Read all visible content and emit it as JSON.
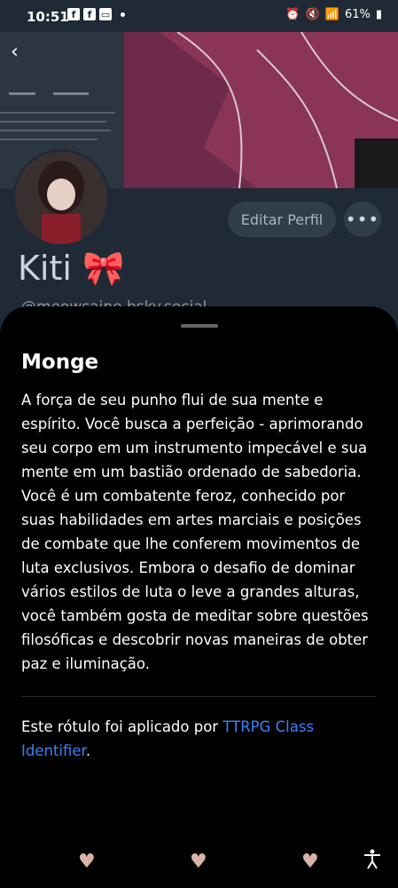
{
  "status": {
    "time": "10:51",
    "battery": "61%"
  },
  "profile": {
    "name": "Kiti 🎀",
    "handle": "@meowsaine.bsky.social",
    "edit_label": "Editar Perfil",
    "more_label": "•••",
    "back_label": "‹"
  },
  "sheet": {
    "title": "Monge",
    "description": "A força de seu punho flui de sua mente e espírito. Você busca a perfeição - aprimorando seu corpo em um instrumento impecável e sua mente em um bastião ordenado de sabedoria. Você é um combatente feroz, conhecido por suas habilidades em artes marciais e posições de combate que lhe conferem movimentos de luta exclusivos. Embora o desafio de dominar vários estilos de luta o leve a grandes alturas, você também gosta de meditar sobre questões filosóficas e descobrir novas maneiras de obter paz e iluminação.",
    "applied_prefix": "Este rótulo foi aplicado por ",
    "applied_link": "TTRPG Class Identifier",
    "applied_suffix": "."
  },
  "nav": {
    "heart": "♥",
    "accessibility": "🯅"
  },
  "colors": {
    "background": "#1f2a36",
    "sheet": "#000000",
    "link": "#3b82f6",
    "banner_flower": "#6e2a4a"
  }
}
